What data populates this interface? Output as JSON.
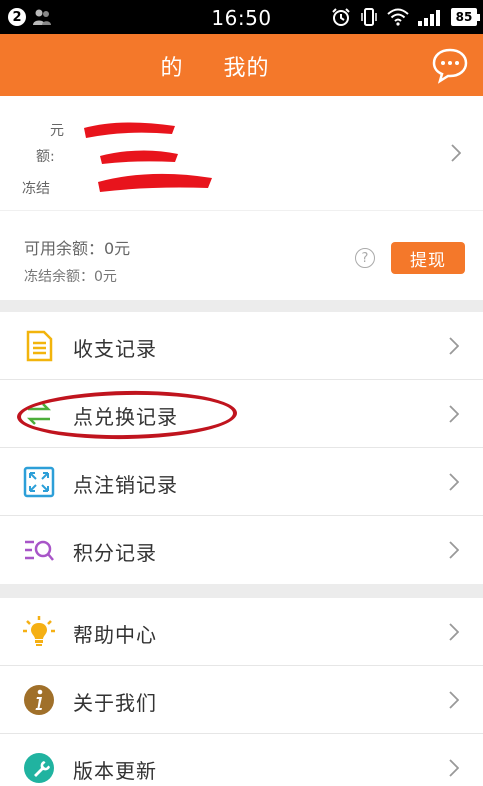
{
  "status_bar": {
    "notification_count": "2",
    "time": "16:50",
    "battery": "85"
  },
  "header": {
    "title_prefix": "的",
    "title": "我的"
  },
  "account": {
    "line1": "元",
    "line2": "额:",
    "line3": "冻结"
  },
  "balance": {
    "available": "可用余额：0元",
    "frozen": "冻结余额：0元",
    "help_symbol": "?",
    "withdraw_label": "提现"
  },
  "menu_group1": [
    {
      "label": "收支记录",
      "icon": "document-icon"
    },
    {
      "label": "点兑换记录",
      "icon": "exchange-icon"
    },
    {
      "label": "点注销记录",
      "icon": "expand-icon"
    },
    {
      "label": "积分记录",
      "icon": "search-list-icon"
    }
  ],
  "menu_group2": [
    {
      "label": "帮助中心",
      "icon": "lightbulb-icon"
    },
    {
      "label": "关于我们",
      "icon": "info-icon"
    },
    {
      "label": "版本更新",
      "icon": "wrench-icon"
    }
  ],
  "colors": {
    "accent": "#f4782a",
    "highlight": "#c0141e"
  }
}
